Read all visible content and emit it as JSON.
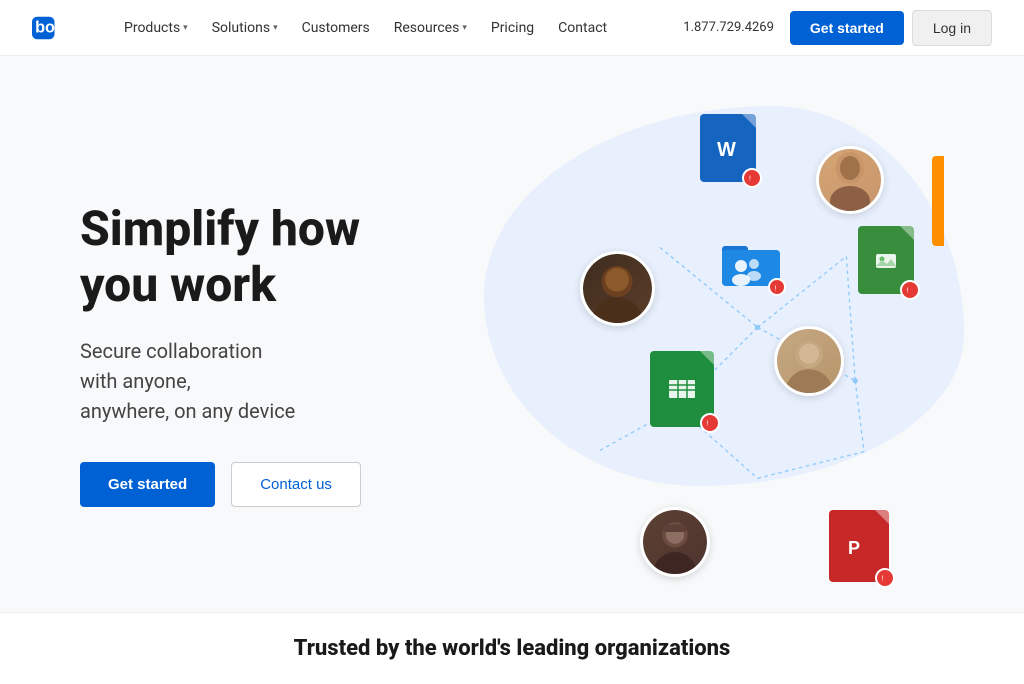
{
  "nav": {
    "logo_alt": "Box",
    "links": [
      {
        "label": "Products",
        "has_dropdown": true
      },
      {
        "label": "Solutions",
        "has_dropdown": true
      },
      {
        "label": "Customers",
        "has_dropdown": false
      },
      {
        "label": "Resources",
        "has_dropdown": true
      },
      {
        "label": "Pricing",
        "has_dropdown": false
      },
      {
        "label": "Contact",
        "has_dropdown": false
      }
    ],
    "phone": "1.877.729.4269",
    "get_started": "Get started",
    "login": "Log in"
  },
  "hero": {
    "title_line1": "Simplify how",
    "title_line2": "you work",
    "subtitle_line1": "Secure collaboration",
    "subtitle_line2": "with anyone,",
    "subtitle_line3": "anywhere, on any device",
    "btn_start": "Get started",
    "btn_contact": "Contact us"
  },
  "trusted": {
    "text": "Trusted by the world's leading organizations"
  },
  "colors": {
    "blue": "#0061d5",
    "word_blue": "#1565c0",
    "sheets_green": "#1e8e3e",
    "slides_red": "#c62828",
    "folder_blue": "#1976d2",
    "image_green": "#388e3c"
  }
}
